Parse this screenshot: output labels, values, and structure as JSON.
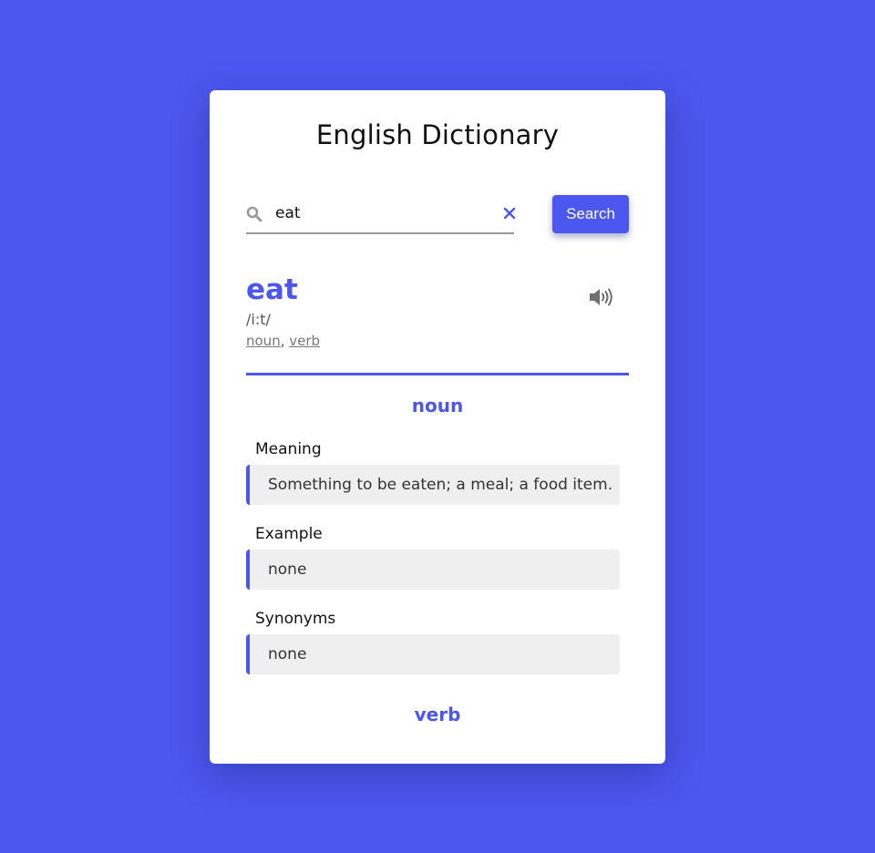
{
  "app": {
    "title": "English Dictionary"
  },
  "search": {
    "value": "eat",
    "placeholder": "",
    "button_label": "Search",
    "icon": "search-icon",
    "clear_icon": "close-icon"
  },
  "word": {
    "text": "eat",
    "phonetic": "/i:t/",
    "parts_of_speech": [
      "noun",
      "verb"
    ],
    "separator": ", ",
    "audio_icon": "speaker-icon"
  },
  "entries": [
    {
      "pos": "noun",
      "sections": [
        {
          "label": "Meaning",
          "value": "Something to be eaten; a meal; a food item."
        },
        {
          "label": "Example",
          "value": "none"
        },
        {
          "label": "Synonyms",
          "value": "none"
        }
      ]
    },
    {
      "pos": "verb"
    }
  ],
  "colors": {
    "background": "#4b57ee",
    "accent": "#4b57ee",
    "card": "#ffffff",
    "section_bg": "#efefef"
  }
}
